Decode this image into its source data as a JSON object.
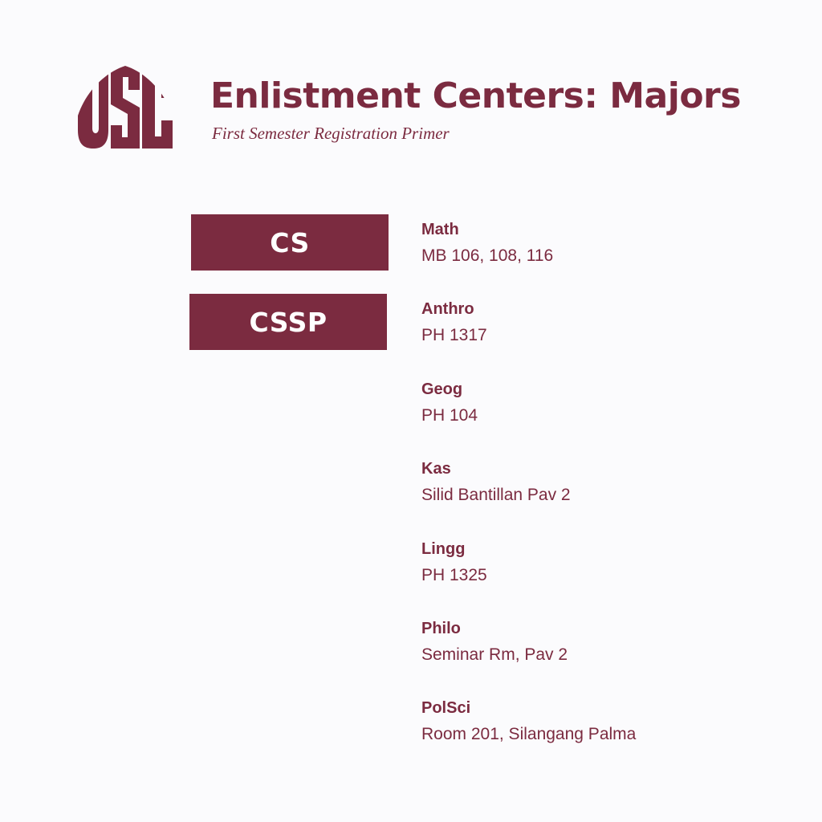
{
  "header": {
    "title": "Enlistment Centers: Majors",
    "subtitle": "First Semester Registration Primer",
    "logo_text": "USC"
  },
  "colleges": [
    {
      "label": "CS"
    },
    {
      "label": "CSSP"
    }
  ],
  "entries": [
    {
      "name": "Math",
      "location": "MB 106, 108, 116"
    },
    {
      "name": "Anthro",
      "location": "PH 1317"
    },
    {
      "name": "Geog",
      "location": "PH 104"
    },
    {
      "name": "Kas",
      "location": "Silid Bantillan Pav 2"
    },
    {
      "name": "Lingg",
      "location": "PH 1325"
    },
    {
      "name": "Philo",
      "location": "Seminar Rm, Pav 2"
    },
    {
      "name": "PolSci",
      "location": "Room 201, Silangang Palma"
    }
  ],
  "colors": {
    "brand": "#7b2b40",
    "background": "#fbfbfd",
    "tab_text": "#ffffff"
  },
  "icons": {
    "logo": "usc-logo-icon"
  }
}
